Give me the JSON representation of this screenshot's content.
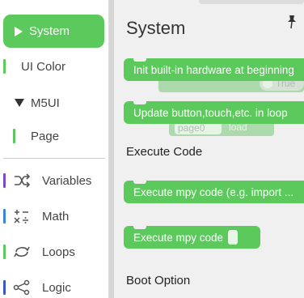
{
  "toolbox": {
    "selected": {
      "label": "System",
      "color": "#5cc95c"
    },
    "items": [
      {
        "label": "UI Color",
        "bar_color": "#5cc95c"
      },
      {
        "label": "M5UI",
        "expanded": true
      },
      {
        "label": "Page",
        "bar_color": "#5cc95c"
      },
      {
        "label": "Variables",
        "bar_color": "#7a4ccc",
        "icon": "shuffle-icon"
      },
      {
        "label": "Math",
        "bar_color": "#3a86d6",
        "icon": "math-operators-icon"
      },
      {
        "label": "Loops",
        "bar_color": "#5cc95c",
        "icon": "loop-arrows-icon"
      },
      {
        "label": "Logic",
        "bar_color": "#3a55c8",
        "icon": "logic-nodes-icon"
      }
    ]
  },
  "flyout": {
    "title": "System",
    "pin_icon": "pin-icon",
    "blocks": [
      {
        "label": "Init built-in hardware at beginning"
      },
      {
        "label": "Update button,touch,etc. in loop"
      }
    ],
    "sections": {
      "execute": "Execute Code",
      "boot": "Boot Option"
    },
    "execute_blocks": [
      {
        "label": "Execute mpy code (e.g. import ..."
      },
      {
        "label": "Execute mpy code"
      }
    ],
    "ghost": {
      "toggle_text": "True",
      "page_text": "page0",
      "load_text": "load"
    }
  }
}
